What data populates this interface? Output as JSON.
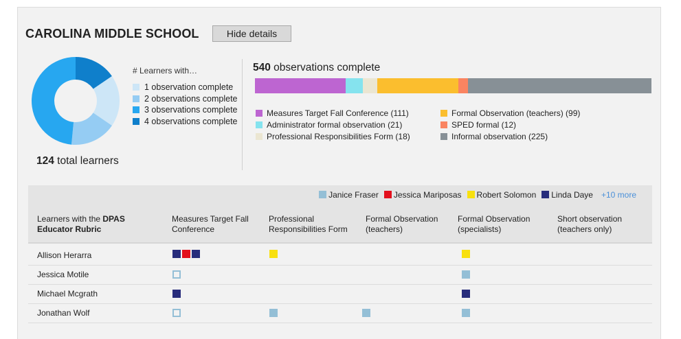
{
  "school": {
    "title": "CAROLINA MIDDLE SCHOOL",
    "hide_label": "Hide details"
  },
  "learners": {
    "legend_title": "# Learners with…",
    "legend": [
      {
        "label": "1 observation complete",
        "color": "#cde6f7"
      },
      {
        "label": "2 observations complete",
        "color": "#95ccf3"
      },
      {
        "label": "3 observations complete",
        "color": "#27a7f0"
      },
      {
        "label": "4 observations complete",
        "color": "#0f7fcb"
      }
    ],
    "donut_slices": [
      {
        "label": "4 observations complete",
        "fraction": 0.155,
        "color": "#0f7fcb"
      },
      {
        "label": "1 observation complete",
        "fraction": 0.19,
        "color": "#cde6f7"
      },
      {
        "label": "2 observations complete",
        "fraction": 0.17,
        "color": "#95ccf3"
      },
      {
        "label": "3 observations complete",
        "fraction": 0.485,
        "color": "#27a7f0"
      }
    ],
    "total_number": "124",
    "total_label": " total learners"
  },
  "observations": {
    "count": "540",
    "label": " observations complete",
    "segments": [
      {
        "label": "Measures Target Fall Conference (111)",
        "value": 111,
        "color": "#bd65d1"
      },
      {
        "label": "Administrator formal observation (21)",
        "value": 21,
        "color": "#85e3ee"
      },
      {
        "label": "Professional Responsibilities Form (18)",
        "value": 18,
        "color": "#ebe6d2"
      },
      {
        "label": "Formal Observation (teachers) (99)",
        "value": 99,
        "color": "#fbbe2e"
      },
      {
        "label": "SPED formal (12)",
        "value": 12,
        "color": "#fa8461"
      },
      {
        "label": "Informal observation (225)",
        "value": 225,
        "color": "#879096"
      }
    ]
  },
  "observers": {
    "items": [
      {
        "name": "Janice Fraser",
        "color": "#94bfd6"
      },
      {
        "name": "Jessica Mariposas",
        "color": "#e3101d"
      },
      {
        "name": "Robert Solomon",
        "color": "#f8e00f"
      },
      {
        "name": "Linda Daye",
        "color": "#282d7c"
      }
    ],
    "more": "+10 more"
  },
  "table": {
    "header_first_prefix": "Learners with the ",
    "header_first_bold": "DPAS",
    "header_first_suffix": "Educator Rubric",
    "columns": [
      "Measures Target Fall Conference",
      "Professional Responsibilities Form",
      "Formal Observation (teachers)",
      "Formal Observation (specialists)",
      "Short observation (teachers only)"
    ],
    "rows": [
      {
        "name": "Allison Herarra",
        "cells": [
          [
            "#282d7c",
            "#e3101d",
            "#282d7c"
          ],
          [
            "#f8e00f"
          ],
          [],
          [
            "#f8e00f"
          ],
          []
        ]
      },
      {
        "name": "Jessica Motile",
        "cells": [
          [
            "outline"
          ],
          [],
          [],
          [
            "#94bfd6"
          ],
          []
        ]
      },
      {
        "name": "Michael Mcgrath",
        "cells": [
          [
            "#282d7c"
          ],
          [],
          [],
          [
            "#282d7c"
          ],
          []
        ]
      },
      {
        "name": "Jonathan Wolf",
        "cells": [
          [
            "outline"
          ],
          [
            "#94bfd6"
          ],
          [
            "#94bfd6"
          ],
          [
            "#94bfd6"
          ],
          []
        ]
      }
    ]
  }
}
